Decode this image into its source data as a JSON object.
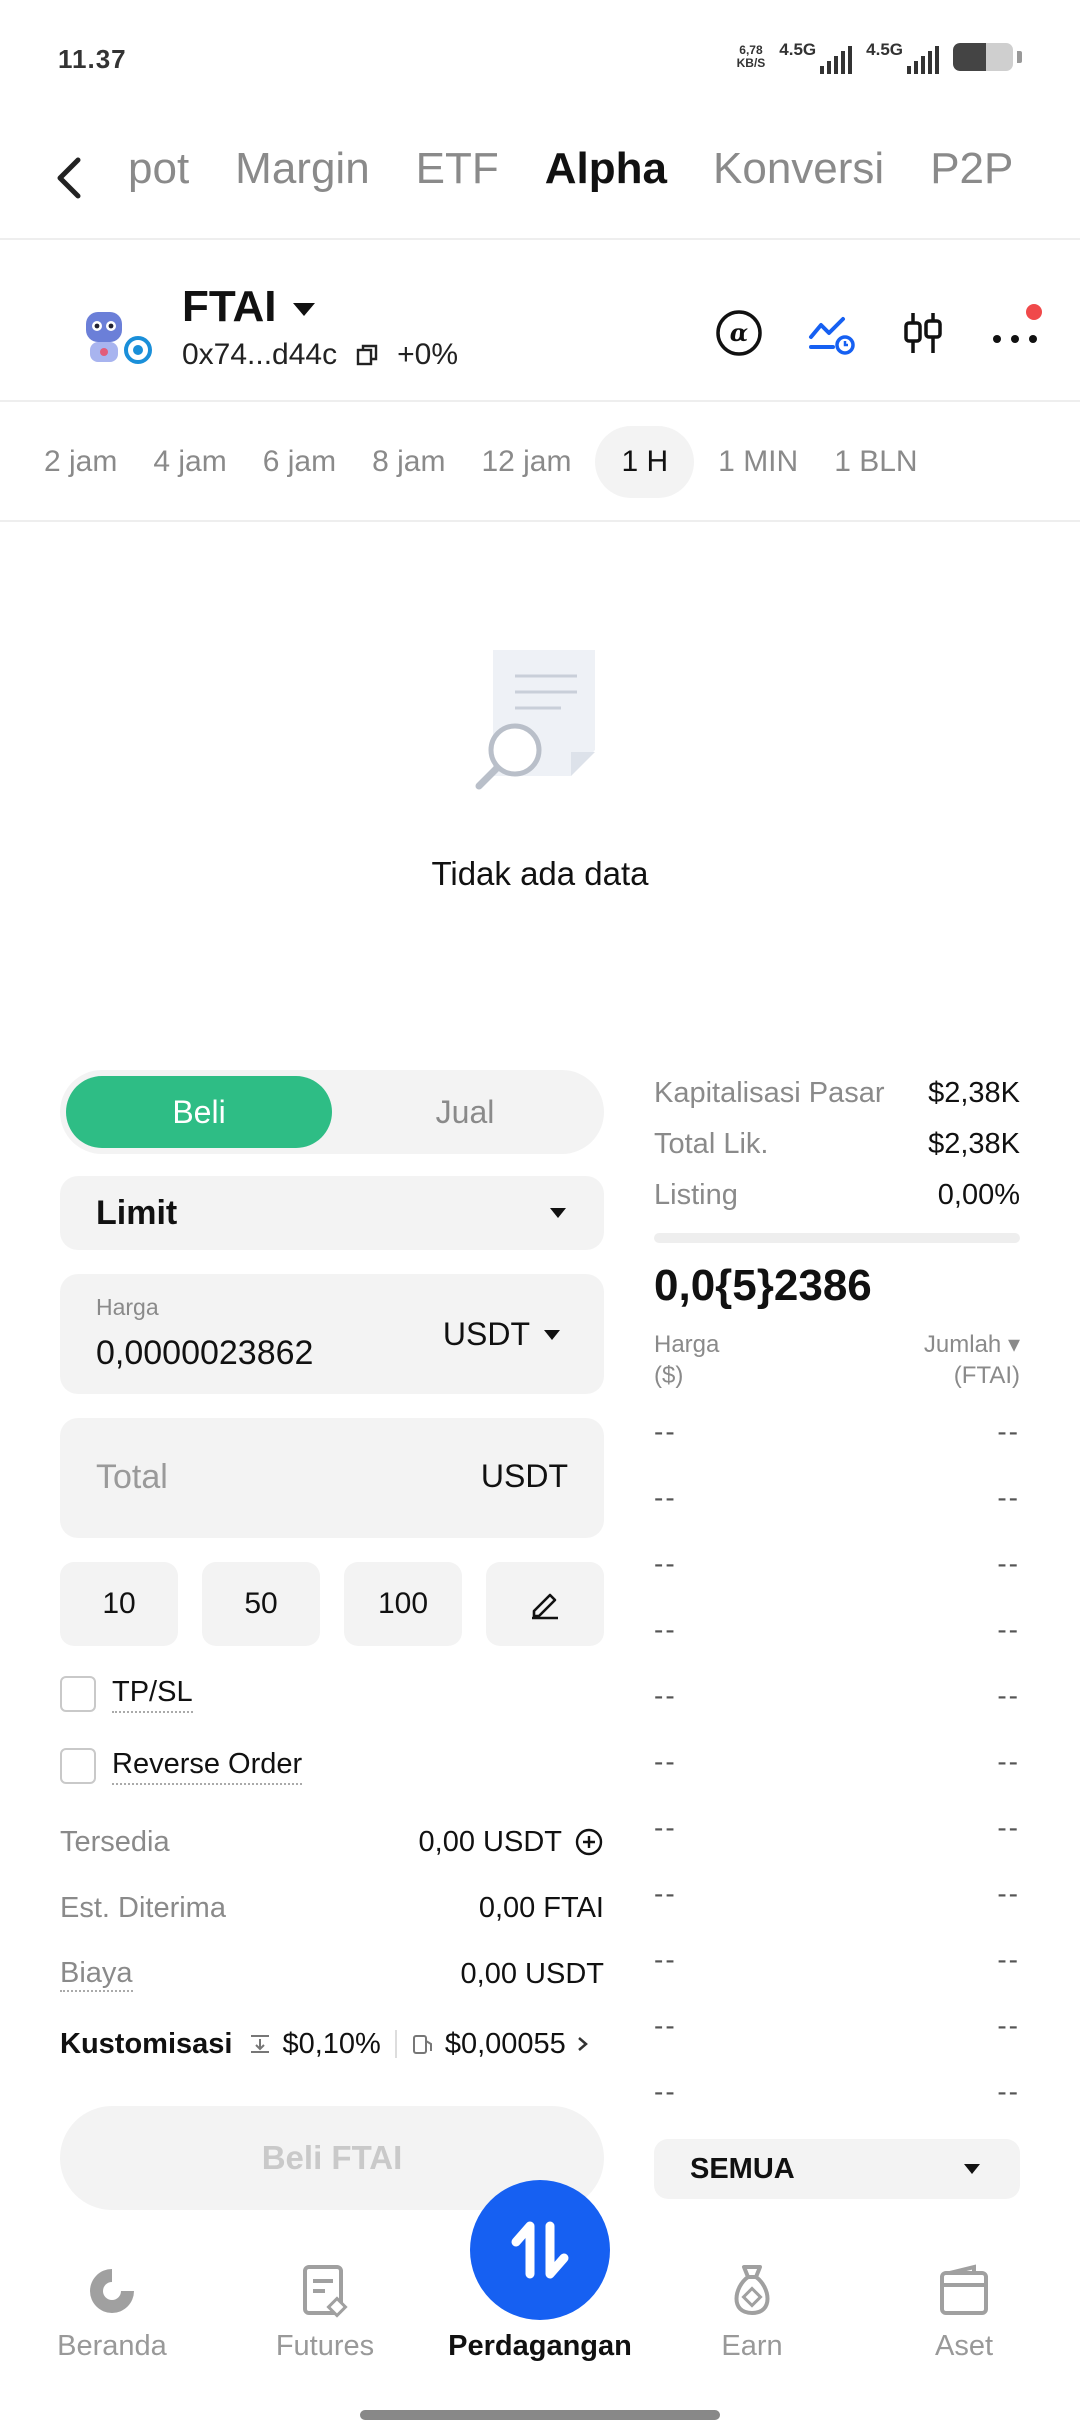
{
  "status_bar": {
    "time": "11.37",
    "speed_top": "6,78",
    "speed_bottom": "KB/S",
    "network_1": "4.5G",
    "network_2": "4.5G",
    "battery_level": 0.55
  },
  "top_nav": {
    "tabs": [
      "pot",
      "Margin",
      "ETF",
      "Alpha",
      "Konversi",
      "P2P"
    ],
    "active_tab": "Alpha"
  },
  "token": {
    "name": "FTAI",
    "address": "0x74...d44c",
    "change": "+0%"
  },
  "intervals": [
    "2 jam",
    "4 jam",
    "6 jam",
    "8 jam",
    "12 jam",
    "1 H",
    "1 MIN",
    "1 BLN"
  ],
  "empty_state": {
    "text": "Tidak ada data"
  },
  "order_form": {
    "buy_label": "Beli",
    "sell_label": "Jual",
    "order_type": "Limit",
    "price_label": "Harga",
    "price_value": "0,0000023862",
    "price_unit": "USDT",
    "total_placeholder": "Total",
    "total_unit": "USDT",
    "presets": [
      "10",
      "50",
      "100"
    ],
    "tpsl_label": "TP/SL",
    "reverse_label": "Reverse Order",
    "available_label": "Tersedia",
    "available_value": "0,00 USDT",
    "est_label": "Est. Diterima",
    "est_value": "0,00 FTAI",
    "fee_label": "Biaya",
    "fee_value": "0,00 USDT",
    "custom_label": "Kustomisasi",
    "custom_slippage": "$0,10%",
    "custom_gas": "$0,00055",
    "buy_button": "Beli FTAI"
  },
  "market": {
    "rows": [
      {
        "label": "Kapitalisasi Pasar",
        "value": "$2,38K"
      },
      {
        "label": "Total Lik.",
        "value": "$2,38K"
      },
      {
        "label": "Listing",
        "value": "0,00%"
      }
    ],
    "price": "0,0{5}2386",
    "col_price": "Harga",
    "col_price_unit": "($)",
    "col_amount": "Jumlah",
    "col_amount_unit": "(FTAI)",
    "empty_cell": "--",
    "filter": "SEMUA"
  },
  "bottom_nav": {
    "items": [
      {
        "label": "Beranda",
        "icon": "home-icon"
      },
      {
        "label": "Futures",
        "icon": "futures-icon"
      },
      {
        "label": "Perdagangan",
        "icon": "trade-icon"
      },
      {
        "label": "Earn",
        "icon": "earn-icon"
      },
      {
        "label": "Aset",
        "icon": "wallet-icon"
      }
    ],
    "active": "Perdagangan"
  },
  "colors": {
    "buy_green": "#2ebd85",
    "accent_blue": "#1660f2",
    "notification_red": "#f0494a"
  }
}
